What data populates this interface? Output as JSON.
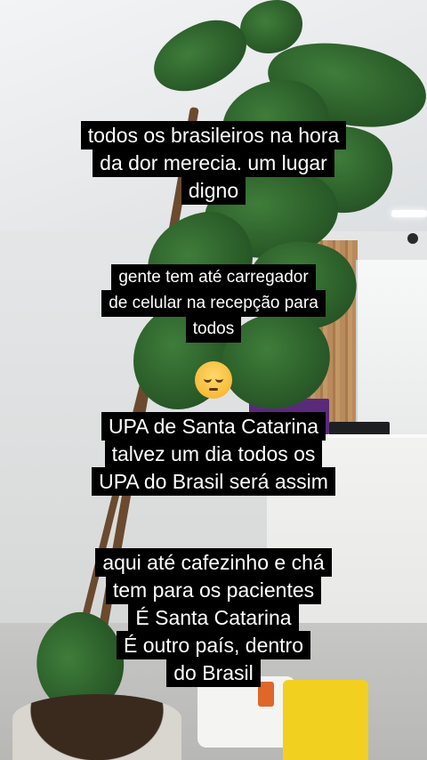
{
  "captions": {
    "block1": [
      "todos os brasileiros na hora",
      "da dor merecia. um lugar",
      "digno"
    ],
    "block2": [
      "gente tem até carregador",
      "de celular na recepção para",
      "todos"
    ],
    "block3": [
      "UPA de Santa Catarina",
      "talvez um dia todos os",
      "UPA do Brasil será assim"
    ],
    "block4": [
      "aqui até cafezinho e chá",
      "tem para os pacientes",
      "É  Santa Catarina",
      "É outro país, dentro",
      "do Brasil"
    ]
  },
  "emoji": "pensive-face-icon"
}
